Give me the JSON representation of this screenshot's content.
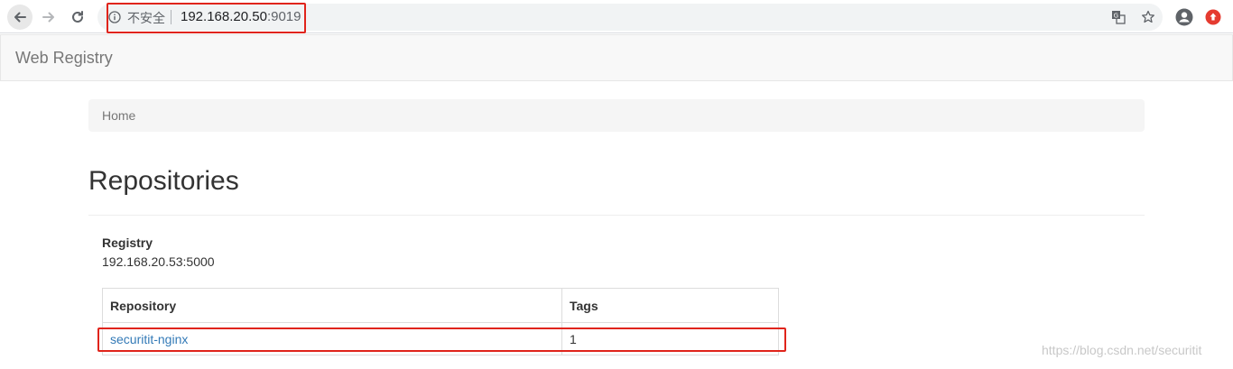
{
  "browser": {
    "insecure_label": "不安全",
    "url_host": "192.168.20.50",
    "url_port": ":9019"
  },
  "navbar": {
    "brand": "Web Registry"
  },
  "breadcrumb": {
    "home": "Home"
  },
  "page": {
    "title": "Repositories"
  },
  "registry": {
    "label": "Registry",
    "address": "192.168.20.53:5000"
  },
  "table": {
    "headers": [
      "Repository",
      "Tags"
    ],
    "rows": [
      {
        "repository": "securitit-nginx",
        "tags": "1"
      }
    ]
  },
  "watermark": "https://blog.csdn.net/securitit",
  "colors": {
    "link": "#337ab7",
    "highlight": "#e0241b"
  }
}
